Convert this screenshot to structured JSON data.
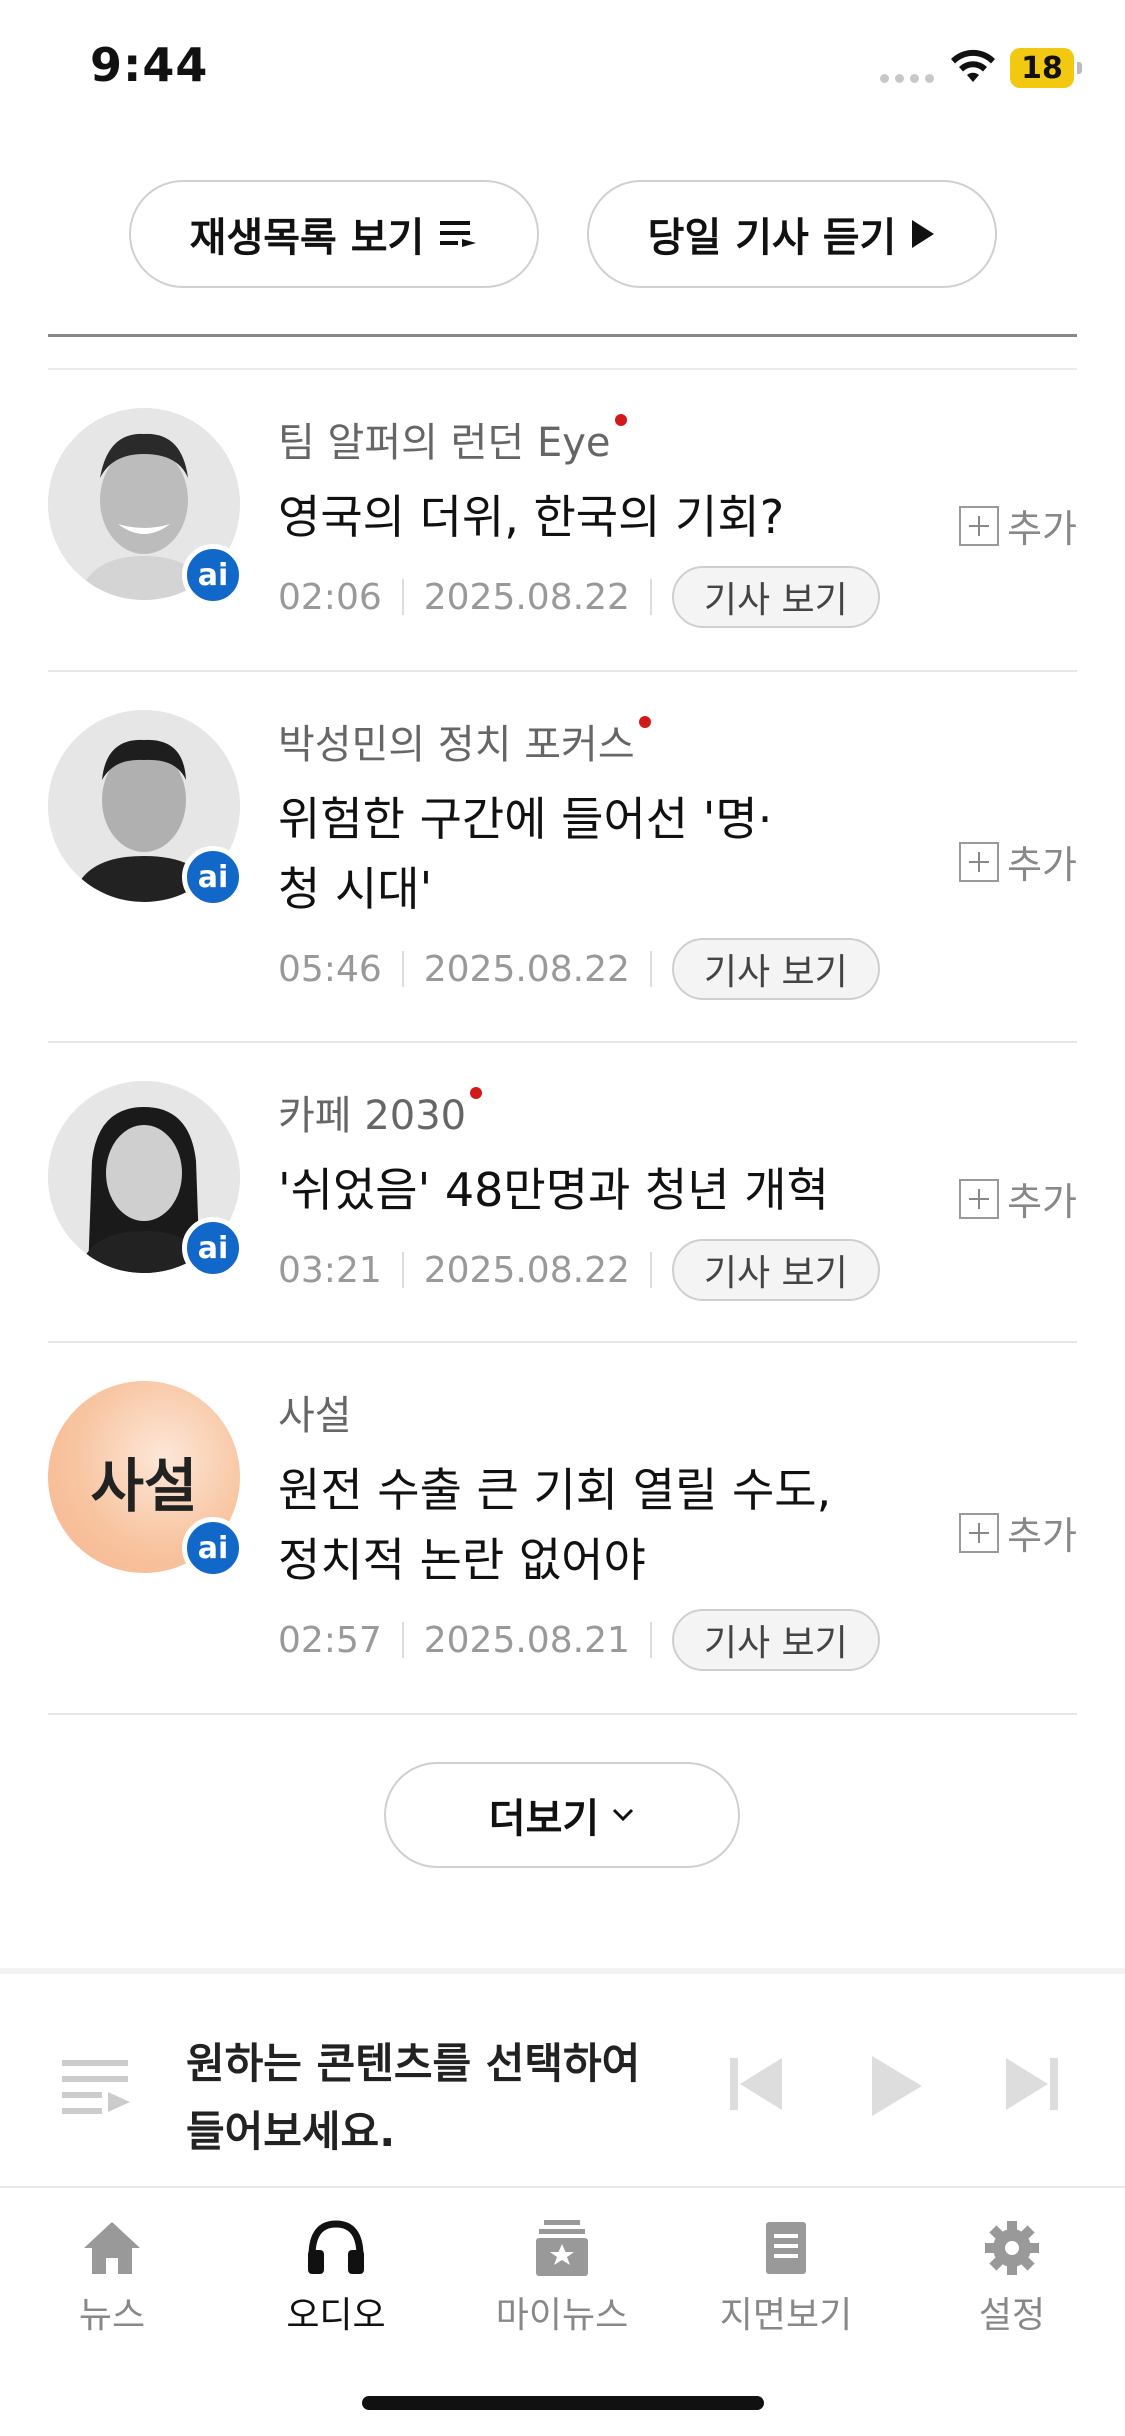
{
  "status": {
    "time": "9:44",
    "battery": "18"
  },
  "top_buttons": {
    "playlist": "재생목록 보기",
    "listen_today": "당일 기사 듣기"
  },
  "items": [
    {
      "column": "팀 알퍼의 런던 Eye",
      "title_lines": [
        "영국의 더위, 한국의 기회?"
      ],
      "duration": "02:06",
      "date": "2025.08.22",
      "view": "기사 보기",
      "add": "추가",
      "badge": "ai",
      "is_new": true
    },
    {
      "column": "박성민의 정치 포커스",
      "title_lines": [
        "위험한 구간에 들어선 '명·",
        "청 시대'"
      ],
      "duration": "05:46",
      "date": "2025.08.22",
      "view": "기사 보기",
      "add": "추가",
      "badge": "ai",
      "is_new": true
    },
    {
      "column": "카페 2030",
      "title_lines": [
        "'쉬었음' 48만명과 청년 개혁"
      ],
      "duration": "03:21",
      "date": "2025.08.22",
      "view": "기사 보기",
      "add": "추가",
      "badge": "ai",
      "is_new": true
    },
    {
      "column": "사설",
      "avatar_text": "사설",
      "title_lines": [
        "원전 수출 큰 기회 열릴 수도,",
        "정치적 논란 없어야"
      ],
      "duration": "02:57",
      "date": "2025.08.21",
      "view": "기사 보기",
      "add": "추가",
      "badge": "ai",
      "is_new": false
    }
  ],
  "more": "더보기",
  "player": {
    "message_lines": [
      "원하는 콘텐츠를 선택하여",
      "들어보세요."
    ]
  },
  "tabs": [
    {
      "label": "뉴스",
      "icon": "home-icon",
      "active": false
    },
    {
      "label": "오디오",
      "icon": "headphones-icon",
      "active": true
    },
    {
      "label": "마이뉴스",
      "icon": "star-box-icon",
      "active": false
    },
    {
      "label": "지면보기",
      "icon": "document-icon",
      "active": false
    },
    {
      "label": "설정",
      "icon": "gear-icon",
      "active": false
    }
  ],
  "colors": {
    "accent_blue": "#1268c8",
    "new_dot": "#d21a1a"
  }
}
